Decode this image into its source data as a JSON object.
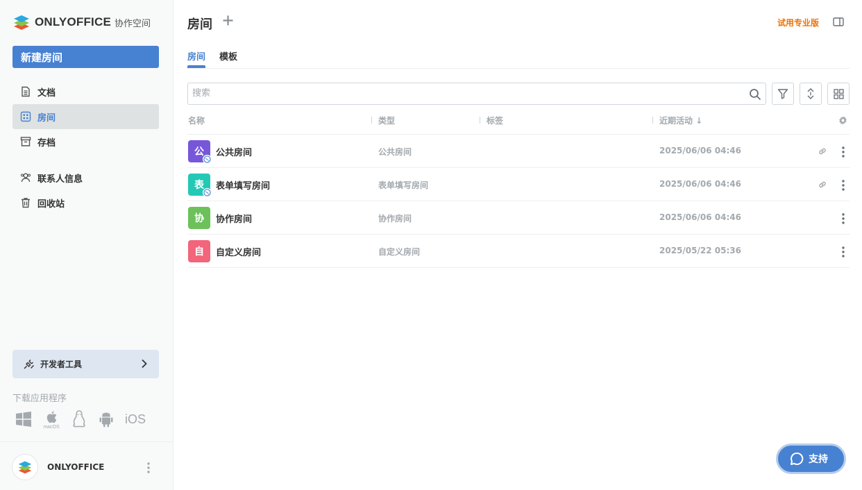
{
  "sidebar": {
    "brand": "ONLYOFFICE",
    "brand_sub": "协作空间",
    "new_room_label": "新建房间",
    "nav": [
      {
        "label": "文档",
        "icon": "document-icon",
        "active": false
      },
      {
        "label": "房间",
        "icon": "rooms-icon",
        "active": true
      },
      {
        "label": "存档",
        "icon": "archive-icon",
        "active": false
      },
      {
        "label": "联系人信息",
        "icon": "contacts-icon",
        "active": false
      },
      {
        "label": "回收站",
        "icon": "trash-icon",
        "active": false
      }
    ],
    "devtools_label": "开发者工具",
    "download_label": "下载应用程序",
    "apps": [
      "windows-icon",
      "macos-icon",
      "linux-icon",
      "android-icon",
      "iOS"
    ],
    "profile_name": "ONLYOFFICE"
  },
  "main": {
    "title": "房间",
    "pro_link": "试用专业版",
    "tabs": [
      {
        "label": "房间",
        "active": true
      },
      {
        "label": "模板",
        "active": false
      }
    ],
    "search_placeholder": "搜索",
    "columns": {
      "name": "名称",
      "type": "类型",
      "tags": "标签",
      "activity": "近期活动 ↓"
    },
    "rooms": [
      {
        "initial": "公",
        "name": "公共房间",
        "type": "公共房间",
        "date": "2025/06/06 04:46",
        "color": "#7757d9",
        "public": true
      },
      {
        "initial": "表",
        "name": "表单填写房间",
        "type": "表单填写房间",
        "date": "2025/06/06 04:46",
        "color": "#23c9b5",
        "public": true
      },
      {
        "initial": "协",
        "name": "协作房间",
        "type": "协作房间",
        "date": "2025/06/06 04:46",
        "color": "#6cc15b",
        "public": false
      },
      {
        "initial": "自",
        "name": "自定义房间",
        "type": "自定义房间",
        "date": "2025/05/22 05:36",
        "color": "#f2657a",
        "public": false
      }
    ],
    "support_label": "支持"
  },
  "colors": {
    "accent": "#4781d1",
    "pro": "#ed7309"
  }
}
